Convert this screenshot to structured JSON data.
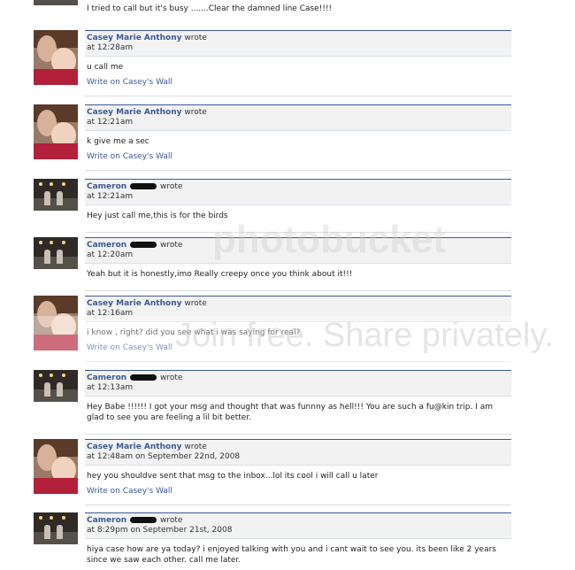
{
  "posts": [
    {
      "type": "partial",
      "message": "I tried to call but it's busy .......Clear the damned line Case!!!!"
    },
    {
      "type": "casey",
      "name": "Casey Marie Anthony",
      "wrote": "wrote",
      "time": "at 12:28am",
      "message": "u call me",
      "wall": "Write on Casey's Wall"
    },
    {
      "type": "casey",
      "name": "Casey Marie Anthony",
      "wrote": "wrote",
      "time": "at 12:21am",
      "message": "k give me a sec",
      "wall": "Write on Casey's Wall"
    },
    {
      "type": "cameron",
      "name": "Cameron",
      "wrote": "wrote",
      "time": "at 12:21am",
      "message": "Hey just call me,this is for the birds"
    },
    {
      "type": "cameron",
      "name": "Cameron",
      "wrote": "wrote",
      "time": "at 12:20am",
      "message": "Yeah but it is honestly,imo Really creepy once you think about it!!!"
    },
    {
      "type": "casey",
      "name": "Casey Marie Anthony",
      "wrote": "wrote",
      "time": "at 12:16am",
      "message": "i know , right? did you see what i was saying for real?",
      "wall": "Write on Casey's Wall"
    },
    {
      "type": "cameron",
      "name": "Cameron",
      "wrote": "wrote",
      "time": "at 12:13am",
      "message": "Hey Babe !!!!!! I got your msg and thought that was funnny as hell!!! You are such a fu@kin trip. I am glad to see you are feeling a lil bit better."
    },
    {
      "type": "casey",
      "name": "Casey Marie Anthony",
      "wrote": "wrote",
      "time": "at 12:48am on September 22nd, 2008",
      "message": "hey you shouldve sent that msg to the inbox...lol its cool i will call u later",
      "wall": "Write on Casey's Wall"
    },
    {
      "type": "cameron",
      "name": "Cameron",
      "wrote": "wrote",
      "time": "at 8:29pm on September 21st, 2008",
      "message": "hiya case how are ya today? i enjoyed talking with you and i cant wait to see you. its been like 2 years since we saw each other. call me later."
    }
  ],
  "watermark": {
    "brand": "photobucket",
    "slogan": "Join free. Share privately."
  }
}
